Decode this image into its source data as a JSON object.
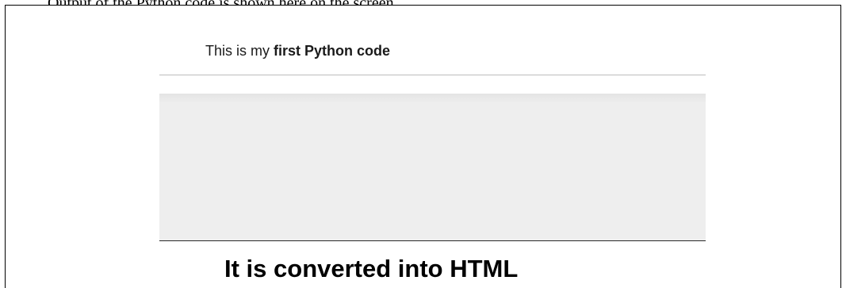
{
  "caption": {
    "text": "Output of the Python code is shown here on the screen"
  },
  "notebook": {
    "intro_prefix": "This is my ",
    "intro_bold": "first Python code",
    "result_heading": "It is converted into HTML"
  }
}
